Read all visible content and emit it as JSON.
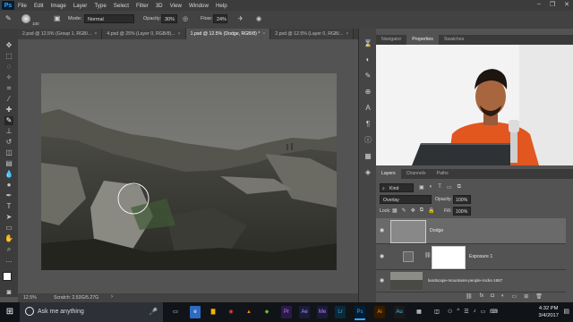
{
  "menubar": {
    "logo": "Ps",
    "items": [
      "File",
      "Edit",
      "Image",
      "Layer",
      "Type",
      "Select",
      "Filter",
      "3D",
      "View",
      "Window",
      "Help"
    ]
  },
  "options": {
    "brush_size": "100",
    "mode_label": "Mode:",
    "mode_value": "Normal",
    "opacity_label": "Opacity:",
    "opacity_value": "30%",
    "flow_label": "Flow:",
    "flow_value": "24%"
  },
  "tabs": [
    {
      "label": "2.psd @ 12.5% (Group 1, RGB/...",
      "active": false
    },
    {
      "label": "4.psd @ 25% (Layer 0, RGB/8)...",
      "active": false
    },
    {
      "label": "1.psd @ 12.5% (Dodge, RGB/8) *",
      "active": true
    },
    {
      "label": "2.psd @ 12.5% (Layer 0, RGB/...",
      "active": false
    }
  ],
  "status": {
    "zoom": "12.5%",
    "scratch": "Scratch: 2.53G/5.27G"
  },
  "top_panel": {
    "tabs": [
      "Navigator",
      "Properties",
      "Swatches"
    ]
  },
  "layers_panel": {
    "tabs": [
      "Layers",
      "Channels",
      "Paths"
    ],
    "kind": "Kind",
    "blend": "Overlay",
    "opacity_label": "Opacity:",
    "opacity": "100%",
    "lock_label": "Lock:",
    "fill_label": "Fill:",
    "fill": "100%",
    "layers": [
      {
        "name": "Dodge"
      },
      {
        "name": "Exposure 1"
      },
      {
        "name": "landscape-mountains-people-rocks-1687"
      }
    ]
  },
  "taskbar": {
    "search_placeholder": "Ask me anything",
    "time": "4:32 PM",
    "date": "3/4/2017"
  }
}
